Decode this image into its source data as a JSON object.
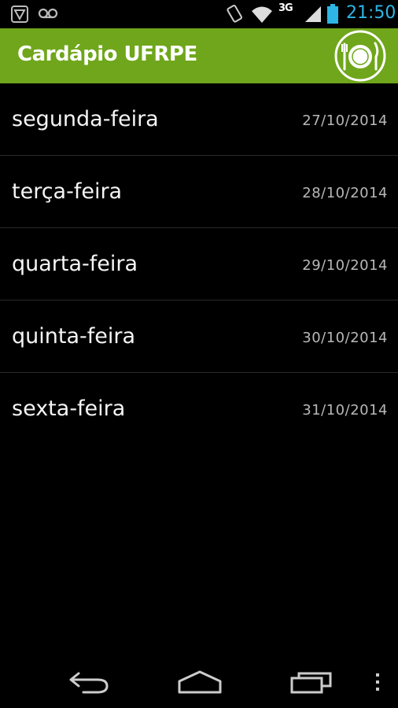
{
  "status_bar": {
    "time": "21:50",
    "network": "3G",
    "icons": [
      "vpn-icon",
      "voicemail-icon",
      "rotation-icon",
      "wifi-icon",
      "signal-icon",
      "battery-icon"
    ],
    "clock_color": "#2eb5e6"
  },
  "action_bar": {
    "title": "Cardápio UFRPE",
    "logo_icon": "plate-fork-knife-icon",
    "background_color": "#6fa61b"
  },
  "days": [
    {
      "name": "segunda-feira",
      "date": "27/10/2014"
    },
    {
      "name": "terça-feira",
      "date": "28/10/2014"
    },
    {
      "name": "quarta-feira",
      "date": "29/10/2014"
    },
    {
      "name": "quinta-feira",
      "date": "30/10/2014"
    },
    {
      "name": "sexta-feira",
      "date": "31/10/2014"
    }
  ],
  "nav_bar": {
    "icons": [
      "back-icon",
      "home-icon",
      "recent-apps-icon",
      "overflow-menu-icon"
    ]
  }
}
